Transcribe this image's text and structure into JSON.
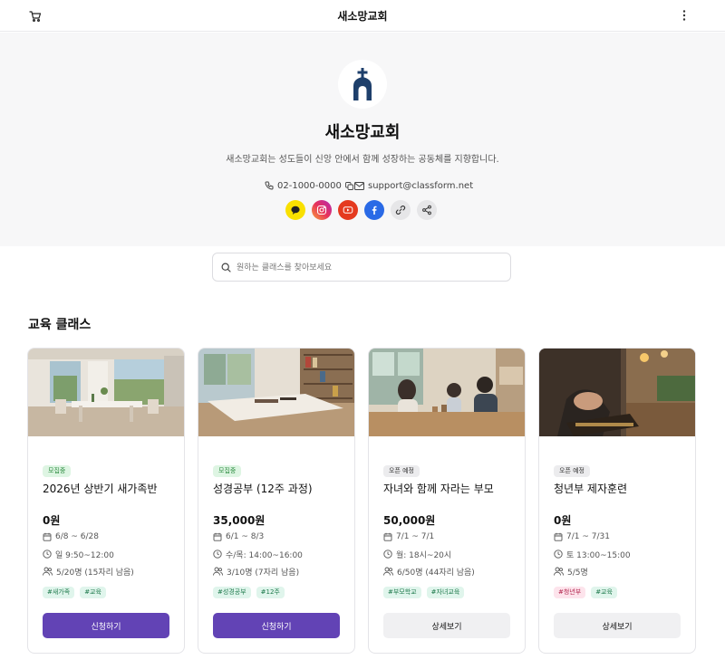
{
  "header": {
    "title": "새소망교회",
    "cart_icon": "cart-icon",
    "more_icon": "more-vertical-icon"
  },
  "profile": {
    "name": "새소망교회",
    "description": "새소망교회는 성도들이 신앙 안에서 함께 성장하는 공동체를 지향합니다.",
    "phone": "02-1000-0000",
    "email": "support@classform.net",
    "social": [
      "kakaotalk-icon",
      "instagram-icon",
      "youtube-icon",
      "facebook-icon",
      "link-icon",
      "share-icon"
    ],
    "colors": {
      "kakao": "#f9e000",
      "youtube": "#e53a1f",
      "facebook": "#2a6ae6"
    }
  },
  "search": {
    "placeholder": "원하는 클래스를 찾아보세요"
  },
  "section": {
    "title": "교육 클래스"
  },
  "classes": [
    {
      "status": "모집중",
      "title": "2026년 상반기 새가족반",
      "price": "0원",
      "dates": "6/8 ~ 6/28",
      "time": "일 9:50~12:00",
      "people": "5/20명 (15자리 남음)",
      "tags": [
        "#새가족",
        "#교육"
      ],
      "button": "신청하기"
    },
    {
      "status": "모집중",
      "title": "성경공부 (12주 과정)",
      "price": "35,000원",
      "dates": "6/1 ~ 8/3",
      "time": "수/목: 14:00~16:00",
      "people": "3/10명 (7자리 남음)",
      "tags": [
        "#성경공부",
        "#12주"
      ],
      "button": "신청하기"
    },
    {
      "status": "오픈 예정",
      "title": "자녀와 함께 자라는 부모",
      "price": "50,000원",
      "dates": "7/1 ~ 7/1",
      "time": "월: 18시~20시",
      "people": "6/50명 (44자리 남음)",
      "tags": [
        "#부모학교",
        "#자녀교육"
      ],
      "button": "상세보기"
    },
    {
      "status": "오픈 예정",
      "title": "청년부 제자훈련",
      "price": "0원",
      "dates": "7/1 ~ 7/31",
      "time": "토 13:00~15:00",
      "people": "5/5명",
      "tags": [
        "#청년부",
        "#교육"
      ],
      "button": "상세보기"
    }
  ],
  "theme": {
    "accent": "#6243b5",
    "open_badge_bg": "#def5e3",
    "soon_badge_bg": "#ececee"
  }
}
